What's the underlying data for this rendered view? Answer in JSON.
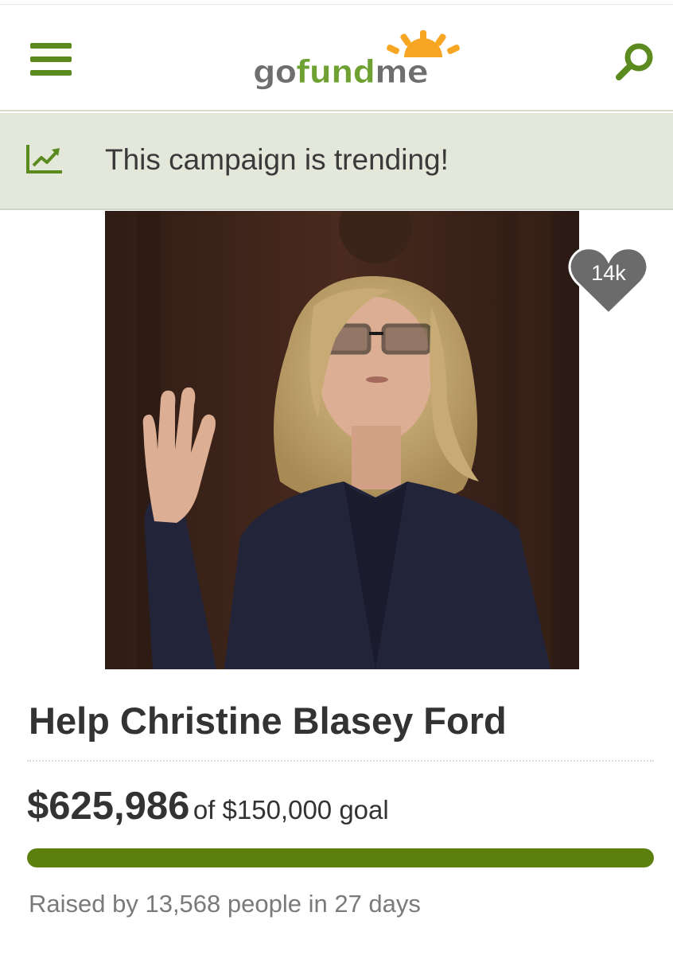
{
  "header": {
    "menu_icon": "hamburger-menu-icon",
    "logo": {
      "go": "go",
      "fund": "fund",
      "me": "me"
    },
    "search_icon": "search-icon",
    "accent": "#5b8a1e"
  },
  "trending": {
    "icon": "trending-chart-icon",
    "text": "This campaign is trending!"
  },
  "campaign": {
    "image_alt": "photo",
    "hearts": "14k",
    "title": "Help Christine Blasey Ford",
    "raised_amount": "$625,986",
    "goal_text": "of $150,000 goal",
    "progress_percent": 100,
    "progress_color": "#5c7f0d",
    "raised_by": "Raised by 13,568 people in 27 days"
  }
}
